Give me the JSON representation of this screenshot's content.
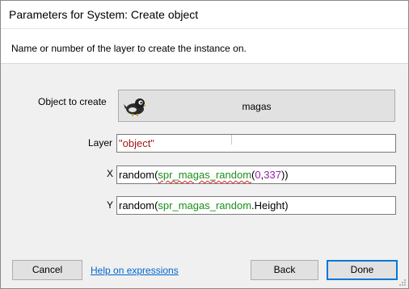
{
  "window": {
    "title": "Parameters for System: Create object"
  },
  "description": "Name or number of the layer to create the instance on.",
  "params": {
    "object": {
      "label": "Object to create",
      "value": "magas",
      "icon": "bird-sprite-icon"
    },
    "layer": {
      "label": "Layer",
      "value": "\"object\""
    },
    "x": {
      "label": "X",
      "value": "random(spr_magas_random(0,337))"
    },
    "y": {
      "label": "Y",
      "value": "random(spr_magas_random.Height)"
    }
  },
  "buttons": {
    "cancel": "Cancel",
    "help": "Help on expressions",
    "back": "Back",
    "done": "Done"
  },
  "colors": {
    "string": "#a31515",
    "identifier": "#1a8f1a",
    "number": "#9b1fa6",
    "accent": "#0078d7",
    "link": "#0066cc"
  }
}
